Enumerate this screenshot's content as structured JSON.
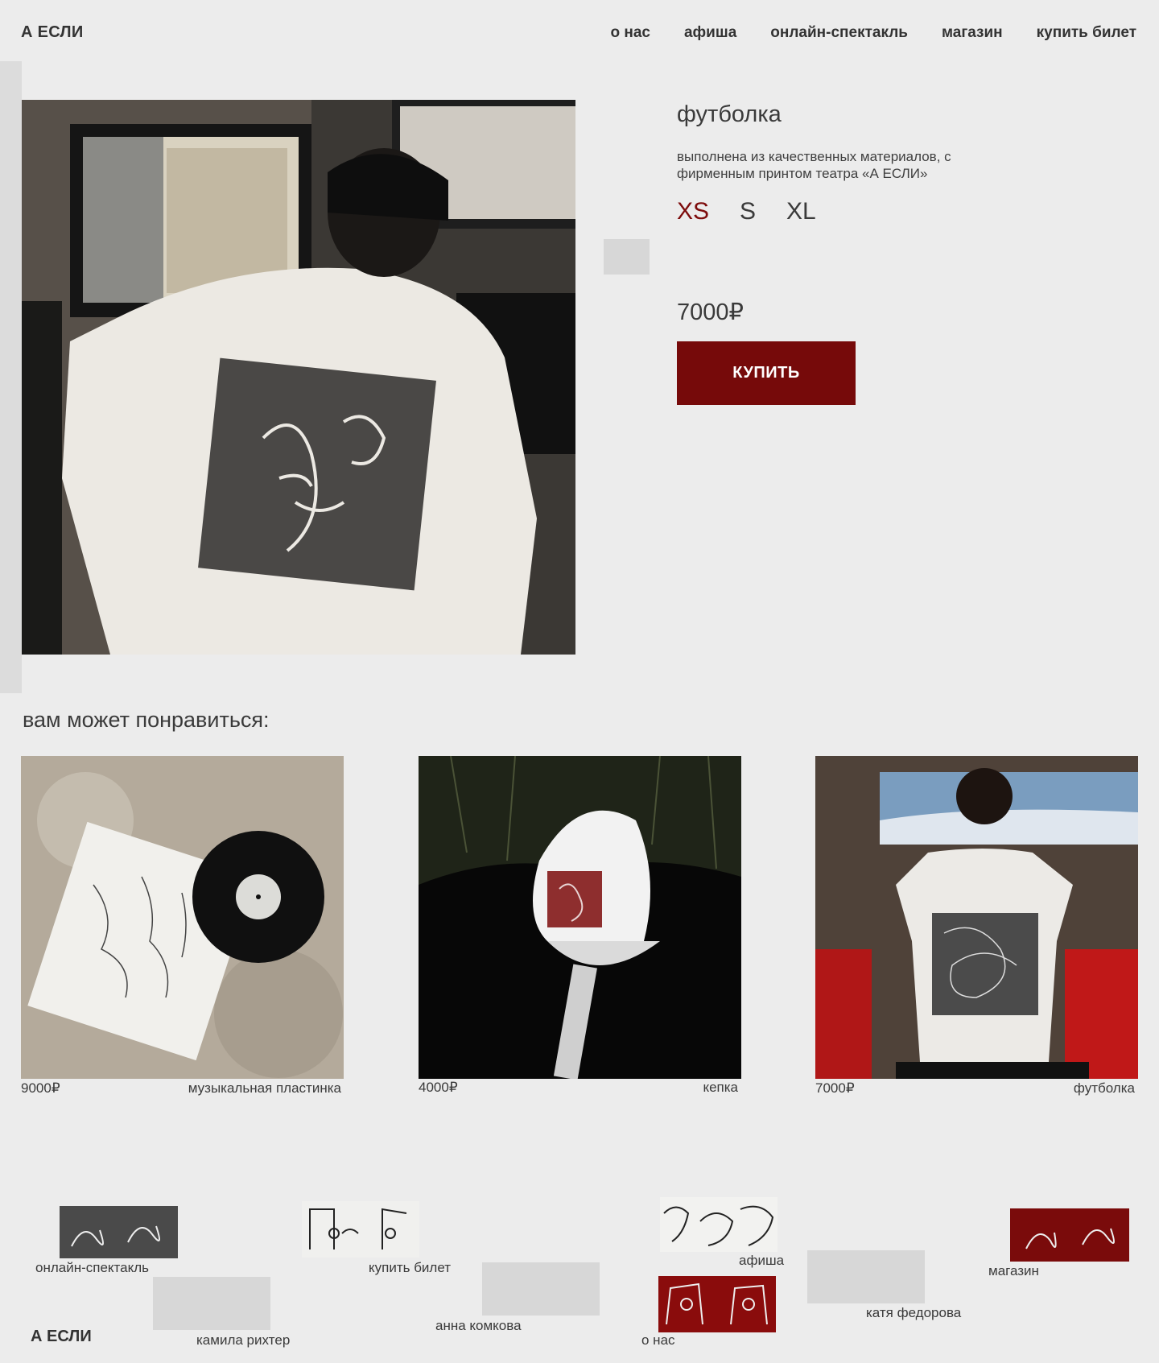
{
  "header": {
    "logo": "А ЕСЛИ",
    "nav": [
      "о нас",
      "афиша",
      "онлайн-спектакль",
      "магазин",
      "купить билет"
    ]
  },
  "product": {
    "title": "футболка",
    "description": "выполнена из качественных материалов, с фирменным принтом театра «А ЕСЛИ»",
    "sizes": [
      "XS",
      "S",
      "XL"
    ],
    "selected_size": "XS",
    "price": "7000₽",
    "buy_label": "КУПИТЬ"
  },
  "related": {
    "heading": "вам может понравиться:",
    "items": [
      {
        "price": "9000₽",
        "name": "музыкальная пластинка"
      },
      {
        "price": "4000₽",
        "name": "кепка"
      },
      {
        "price": "7000₽",
        "name": "футболка"
      }
    ]
  },
  "footer": {
    "links": [
      "онлайн-спектакль",
      "купить билет",
      "афиша",
      "магазин",
      "о нас"
    ],
    "authors": [
      "камила рихтер",
      "анна комкова",
      "катя федорова"
    ],
    "logo": "А ЕСЛИ"
  },
  "colors": {
    "background": "#ececec",
    "accent": "#760a0a",
    "placeholder": "#d7d7d7"
  }
}
